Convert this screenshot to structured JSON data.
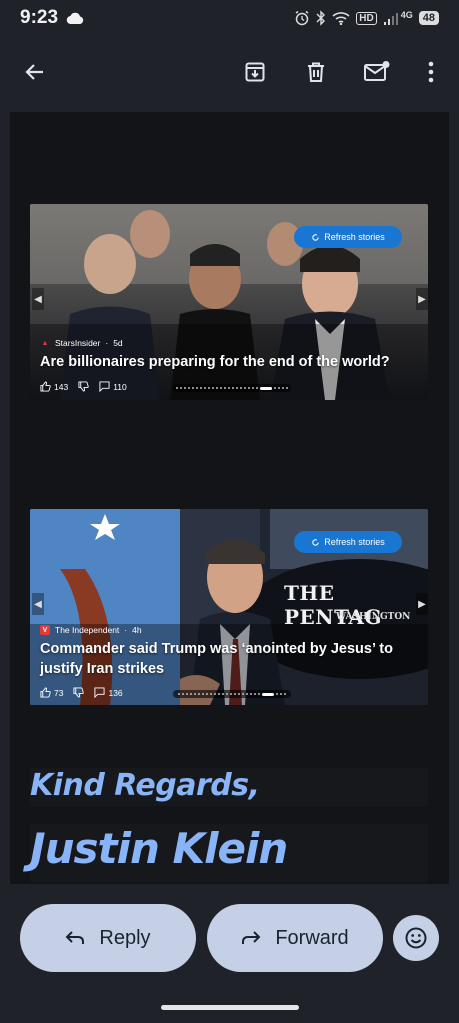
{
  "status_bar": {
    "time": "9:23",
    "hd_label": "HD",
    "network_label": "4G",
    "battery_level": "48"
  },
  "toolbar": {
    "icons": [
      "back-arrow-icon",
      "archive-icon",
      "delete-icon",
      "mark-unread-icon",
      "more-vert-icon"
    ]
  },
  "cards": [
    {
      "refresh_label": "Refresh stories",
      "source_name": "StarsInsider",
      "source_age": "5d",
      "headline": "Are billionaires preparing for the end of the world?",
      "likes": "143",
      "comments": "110"
    },
    {
      "refresh_label": "Refresh stories",
      "source_name": "The Independent",
      "source_age": "4h",
      "headline": "Commander said Trump was ‘anointed by Jesus’ to justify Iran strikes",
      "likes": "73",
      "comments": "136",
      "bg_sign_line1": "THE PENTAG",
      "bg_sign_line2": "WASHINGTON"
    }
  ],
  "signature": {
    "closing": "Kind Regards,",
    "name": "Justin Klein"
  },
  "actions": {
    "reply_label": "Reply",
    "forward_label": "Forward"
  },
  "colors": {
    "background": "#1f2329",
    "content": "#121418",
    "accent": "#8ab4f8",
    "pill": "#c5d0e6",
    "refresh": "#1976d2"
  }
}
